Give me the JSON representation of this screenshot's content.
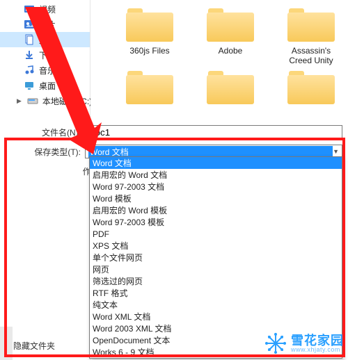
{
  "sidebar": {
    "items": [
      {
        "label": "视频",
        "icon": "video-icon"
      },
      {
        "label": "图片",
        "icon": "pictures-icon"
      },
      {
        "label": "文档",
        "icon": "documents-icon",
        "selected": true
      },
      {
        "label": "下载",
        "icon": "downloads-icon"
      },
      {
        "label": "音乐",
        "icon": "music-icon"
      },
      {
        "label": "桌面",
        "icon": "desktop-icon"
      },
      {
        "label": "本地磁盘 (C:)",
        "icon": "drive-icon",
        "drive": true
      }
    ],
    "hide_folders": "隐藏文件夹"
  },
  "folders_row1": [
    {
      "name": "360js Files"
    },
    {
      "name": "Adobe"
    },
    {
      "name": "Assassin's Creed Unity"
    }
  ],
  "form": {
    "filename_label": "文件名(N):",
    "filename_value": "Doc1",
    "savetype_label": "保存类型(T):",
    "savetype_selected": "Word 文档",
    "author_label": "作者:"
  },
  "savetype_options": [
    "Word 文档",
    "启用宏的 Word 文档",
    "Word 97-2003 文档",
    "Word 模板",
    "启用宏的 Word 模板",
    "Word 97-2003 模板",
    "PDF",
    "XPS 文档",
    "单个文件网页",
    "网页",
    "筛选过的网页",
    "RTF 格式",
    "纯文本",
    "Word XML 文档",
    "Word 2003 XML 文档",
    "OpenDocument 文本",
    "Works 6 - 9 文档"
  ],
  "watermark": {
    "cn": "雪花家园",
    "en": "www.xhjaty.com"
  }
}
